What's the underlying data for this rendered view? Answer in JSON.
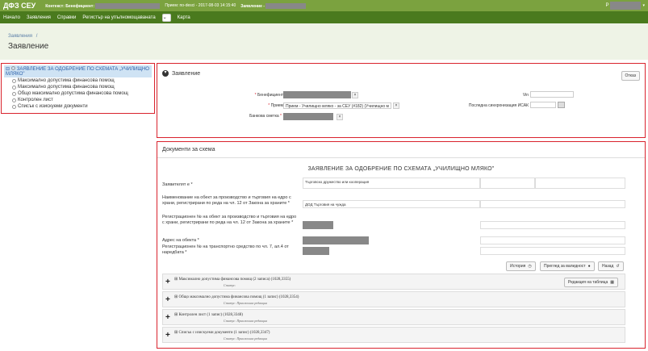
{
  "topbar": {
    "brand": "ДФЗ СЕУ",
    "context_label": "Контекст: Бенефициент:",
    "reception": "Прием: по-desci - 2017-08-03 14:15:40",
    "applicant_label": "Заявление -"
  },
  "nav": {
    "items": [
      "Начало",
      "Заявления",
      "Справки",
      "Регистър на упълномощаваната",
      "Карта"
    ],
    "dropdown_icon": "chevron-down-icon"
  },
  "header": {
    "breadcrumb": "Заявления",
    "breadcrumb_sep": "/",
    "title": "Заявление"
  },
  "tree": {
    "root": "ЗАЯВЛЕНИЕ ЗА ОДОБРЕНИЕ ПО СХЕМАТА „УЧИЛИЩНО МЛЯКО\"",
    "children": [
      "Максимално допустима финансова помощ",
      "Максимално допустима финансова помощ",
      "Общо максимално допустима финансова помощ",
      "Контролен лист",
      "Списък с изискуеми документи"
    ]
  },
  "application_panel": {
    "title": "Заявление",
    "cancel_button": "Отказ",
    "beneficiary_label": "Бенефициент",
    "reception_label": "Прием",
    "reception_value": "Прием - Училищно мляко - за СЕУ (#182) (Училищно м",
    "bank_account_label": "Банкова сметка",
    "vin_label": "Vin",
    "last_sync_label": "Последна синхронизация ИСАК"
  },
  "documents_panel": {
    "title": "Документи за схема",
    "form_title": "ЗАЯВЛЕНИЕ ЗА ОДОБРЕНИЕ ПО СХЕМАТА „УЧИЛИЩНО МЛЯКО\"",
    "applicant_label": "Заявителят е *",
    "applicant_value": "Търговско дружество или кооперация",
    "object_name_label": "Наименование на обект за производство и търговия на едро с храни, регистрирани по реда на чл. 12 от Закона за храните *",
    "object_name_value": "ДОД Търговия на чужда",
    "object_reg_label": "Регистрационен № на обект за производство и търговия на едро с храни, регистрирани по реда на чл. 12 от Закона за храните *",
    "address_label": "Адрес на обекта *",
    "vehicle_reg_label": "Регистрационен № на транспортно средство по чл. 7, ал.4 от наредбата *",
    "history_button": "История",
    "validity_button": "Преглед за валидност",
    "back_button": "Назад",
    "sections": [
      {
        "title": "Максимално допустима финансова помощ (2 записа) (1028,3355)",
        "status": "Статус:",
        "action": "Редакция на таблица"
      },
      {
        "title": "Общо максимално допустима финансова помощ (1 запис) (1028,3354)",
        "status": "Статус: Приключила редакция"
      },
      {
        "title": "Контролен лист (1 запис) (1028,3348)",
        "status": "Статус: Приключила редакция"
      },
      {
        "title": "Списък с изискуеми документи (1 запис) (1028,3347)",
        "status": "Статус: Приключила редакция"
      }
    ]
  }
}
